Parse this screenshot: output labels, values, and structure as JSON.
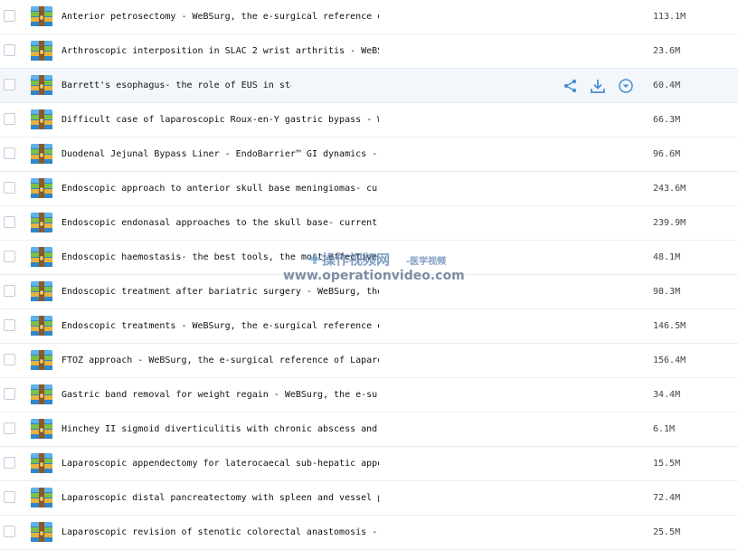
{
  "files": [
    {
      "name": "Anterior petrosectomy - WeBSurg, the e-surgical reference of Laparoscopic Surgery",
      "size": "113.1M"
    },
    {
      "name": "Arthroscopic interposition in SLAC 2 wrist arthritis - WeBSurg",
      "size": "23.6M"
    },
    {
      "name": "Barrett's esophagus- the role of EUS in staging",
      "size": "60.4M"
    },
    {
      "name": "Difficult case of laparoscopic Roux-en-Y gastric bypass - WeBSurg",
      "size": "66.3M"
    },
    {
      "name": "Duodenal Jejunal Bypass Liner - EndoBarrier™ GI dynamics - WeBSurg",
      "size": "96.6M"
    },
    {
      "name": "Endoscopic approach to anterior skull base meningiomas- current",
      "size": "243.6M"
    },
    {
      "name": "Endoscopic endonasal approaches to the skull base- current concepts",
      "size": "239.9M"
    },
    {
      "name": "Endoscopic haemostasis- the best tools, the most effective techniques",
      "size": "48.1M"
    },
    {
      "name": "Endoscopic treatment after bariatric surgery - WeBSurg, the e-surgical reference",
      "size": "98.3M"
    },
    {
      "name": "Endoscopic treatments - WeBSurg, the e-surgical reference of Laparoscopic Surgery",
      "size": "146.5M"
    },
    {
      "name": "FTOZ approach - WeBSurg, the e-surgical reference of Laparoscopic Surgery",
      "size": "156.4M"
    },
    {
      "name": "Gastric band removal for weight regain - WeBSurg, the e-surgical reference",
      "size": "34.4M"
    },
    {
      "name": "Hinchey II sigmoid diverticulitis with chronic abscess and fistula",
      "size": "6.1M"
    },
    {
      "name": "Laparoscopic appendectomy for laterocaecal sub-hepatic appendicitis",
      "size": "15.5M"
    },
    {
      "name": "Laparoscopic distal pancreatectomy with spleen and vessel preservation",
      "size": "72.4M"
    },
    {
      "name": "Laparoscopic revision of stenotic colorectal anastomosis - WeBSurg",
      "size": "25.5M"
    }
  ],
  "hover_row": 2,
  "icons": {
    "file": "archive-file-icon",
    "share": "share-icon",
    "download": "download-icon",
    "more": "chevron-down-circle-icon"
  },
  "colors": {
    "action_icon": "#4a8fd1",
    "hover_bg": "#f3f7fc",
    "divider": "#e9edf2"
  },
  "watermark": {
    "cn": "操作视频网",
    "sub": "-医学视频",
    "url": "www.operationvideo.com"
  }
}
